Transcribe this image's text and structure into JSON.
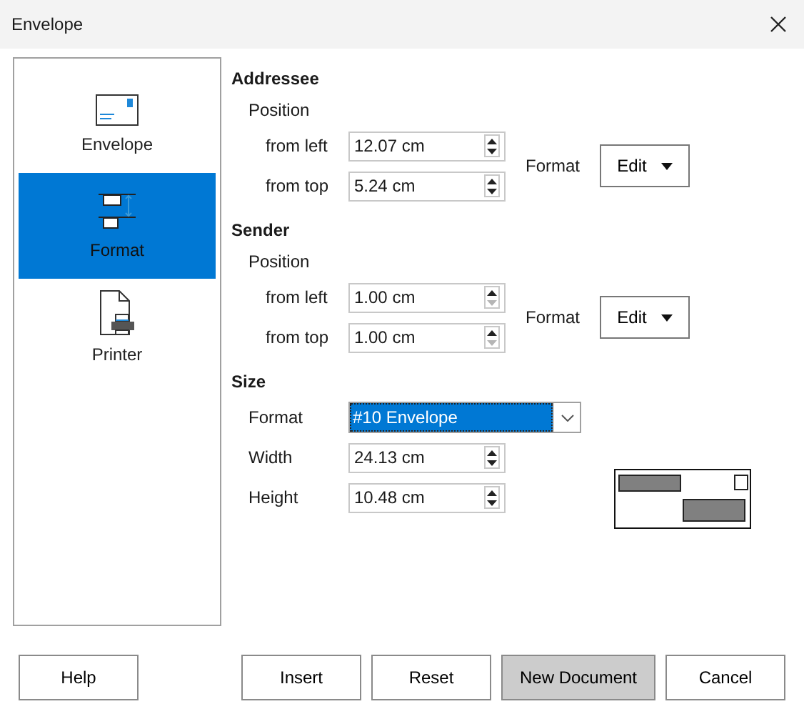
{
  "window": {
    "title": "Envelope"
  },
  "sidebar": {
    "items": [
      {
        "label": "Envelope",
        "kind": "envelope",
        "selected": false
      },
      {
        "label": "Format",
        "kind": "format",
        "selected": true
      },
      {
        "label": "Printer",
        "kind": "printer",
        "selected": false
      }
    ]
  },
  "sections": [
    {
      "title": "Addressee",
      "position_label": "Position",
      "fields": [
        {
          "label": "from left",
          "value": "12.07 cm",
          "decrement_disabled": false
        },
        {
          "label": "from top",
          "value": "5.24 cm",
          "decrement_disabled": false
        }
      ],
      "format_label": "Format",
      "format_button": "Edit"
    },
    {
      "title": "Sender",
      "position_label": "Position",
      "fields": [
        {
          "label": "from left",
          "value": "1.00 cm",
          "decrement_disabled": true
        },
        {
          "label": "from top",
          "value": "1.00 cm",
          "decrement_disabled": true
        }
      ],
      "format_label": "Format",
      "format_button": "Edit"
    }
  ],
  "size": {
    "title": "Size",
    "format_label": "Format",
    "format_value": "#10 Envelope",
    "fields": [
      {
        "label": "Width",
        "value": "24.13 cm",
        "decrement_disabled": false
      },
      {
        "label": "Height",
        "value": "10.48 cm",
        "decrement_disabled": false
      }
    ]
  },
  "buttons": [
    {
      "label": "Help",
      "default": false
    },
    {
      "label": "Insert",
      "default": false
    },
    {
      "label": "Reset",
      "default": false
    },
    {
      "label": "New Document",
      "default": true
    },
    {
      "label": "Cancel",
      "default": false
    }
  ]
}
